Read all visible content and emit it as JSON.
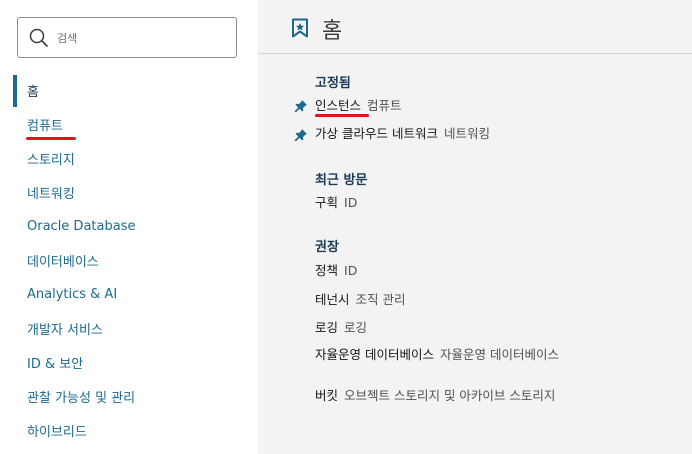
{
  "sidebar": {
    "search_placeholder": "검색",
    "items": [
      {
        "label": "홈"
      },
      {
        "label": "컴퓨트"
      },
      {
        "label": "스토리지"
      },
      {
        "label": "네트워킹"
      },
      {
        "label": "Oracle Database"
      },
      {
        "label": "데이터베이스"
      },
      {
        "label": "Analytics & AI"
      },
      {
        "label": "개발자 서비스"
      },
      {
        "label": "ID & 보안"
      },
      {
        "label": "관찰 가능성 및 관리"
      },
      {
        "label": "하이브리드"
      }
    ]
  },
  "main": {
    "title": "홈",
    "pinned": {
      "heading": "고정됨",
      "items": [
        {
          "name": "인스턴스",
          "category": "컴퓨트"
        },
        {
          "name": "가상 클라우드 네트워크",
          "category": "네트워킹"
        }
      ]
    },
    "recent": {
      "heading": "최근 방문",
      "items": [
        {
          "name": "구획",
          "category": "ID"
        }
      ]
    },
    "recommended": {
      "heading": "권장",
      "items": [
        {
          "name": "정책",
          "category": "ID"
        },
        {
          "name": "테넌시",
          "category": "조직 관리"
        },
        {
          "name": "로깅",
          "category": "로깅"
        },
        {
          "name": "자율운영 데이터베이스",
          "category": "자율운영 데이터베이스"
        },
        {
          "name": "버킷",
          "category": "오브젝트 스토리지 및 아카이브 스토리지"
        }
      ]
    }
  },
  "colors": {
    "link": "#1b6a8d",
    "heading": "#1b3a57",
    "annotation": "#e0131b",
    "main_bg": "#f3f3f3"
  }
}
